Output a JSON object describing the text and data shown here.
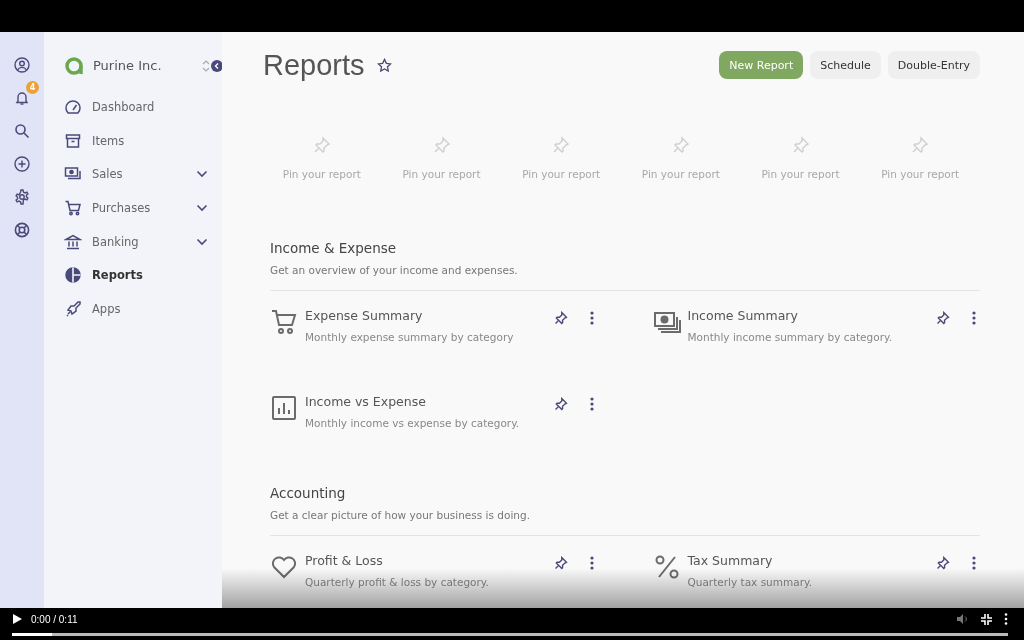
{
  "rail": [
    {
      "kind": "user"
    },
    {
      "kind": "bell",
      "badge": "4"
    },
    {
      "kind": "search"
    },
    {
      "kind": "plus"
    },
    {
      "kind": "settings"
    },
    {
      "kind": "help"
    }
  ],
  "company": {
    "name": "Purine Inc."
  },
  "sidebar": {
    "items": [
      {
        "label": "Dashboard",
        "kind": "dashboard",
        "expandable": false,
        "selected": false
      },
      {
        "label": "Items",
        "kind": "items",
        "expandable": false,
        "selected": false
      },
      {
        "label": "Sales",
        "kind": "sales",
        "expandable": true,
        "selected": false
      },
      {
        "label": "Purchases",
        "kind": "cart",
        "expandable": true,
        "selected": false
      },
      {
        "label": "Banking",
        "kind": "bank",
        "expandable": true,
        "selected": false
      },
      {
        "label": "Reports",
        "kind": "reports",
        "expandable": false,
        "selected": true
      },
      {
        "label": "Apps",
        "kind": "apps",
        "expandable": false,
        "selected": false
      }
    ]
  },
  "page": {
    "title": "Reports",
    "buttons": [
      {
        "label": "New Report",
        "kind": "primary"
      },
      {
        "label": "Schedule",
        "kind": "secondary"
      },
      {
        "label": "Double-Entry",
        "kind": "secondary"
      }
    ]
  },
  "pins": [
    "Pin your report",
    "Pin your report",
    "Pin your report",
    "Pin your report",
    "Pin your report",
    "Pin your report"
  ],
  "sections": [
    {
      "title": "Income & Expense",
      "description": "Get an overview of your income and expenses.",
      "reports": [
        {
          "title": "Expense Summary",
          "description": "Monthly expense summary by category",
          "kind": "cart"
        },
        {
          "title": "Income Summary",
          "description": "Monthly income summary by category.",
          "kind": "money"
        },
        {
          "title": "Income vs Expense",
          "description": "Monthly income vs expense by category.",
          "kind": "chart"
        }
      ]
    },
    {
      "title": "Accounting",
      "description": "Get a clear picture of how your business is doing.",
      "reports": [
        {
          "title": "Profit & Loss",
          "description": "Quarterly profit & loss by category.",
          "kind": "heart"
        },
        {
          "title": "Tax Summary",
          "description": "Quarterly tax summary.",
          "kind": "percent"
        }
      ]
    }
  ],
  "video": {
    "time": "0:00 / 0:11",
    "level": 0.04
  }
}
